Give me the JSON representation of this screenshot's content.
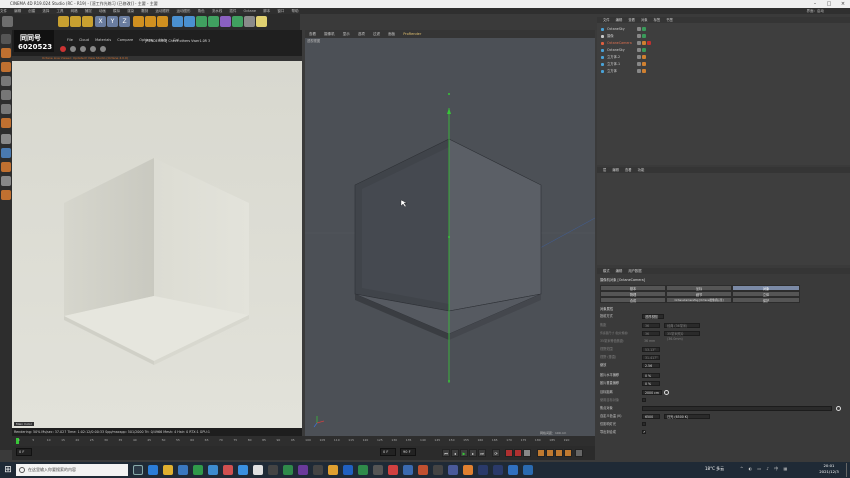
{
  "window": {
    "title": "CINEMA 4D R19.024 Studio (RC - R19) - [渲工作光练习 (已修改)] - 主要 - 主要",
    "menu": [
      "文件",
      "编辑",
      "创建",
      "选择",
      "工具",
      "网格",
      "捕捉",
      "动画",
      "模拟",
      "渲染",
      "雕刻",
      "运动跟踪",
      "运动图形",
      "角色",
      "流水线",
      "插件",
      "Octane",
      "脚本",
      "窗口",
      "帮助"
    ],
    "layout_label": "界面：启动"
  },
  "render_view": {
    "logo_text": "同同号",
    "logo_number": "6020523",
    "menu": [
      "File",
      "Cloud",
      "Materials",
      "Compare",
      "Options",
      "Help",
      "Gui"
    ],
    "info": "[RENDERING] Check others Vwer1.0R 3",
    "warning": "Octane Live Viewer: Updated! View Studio (Octane 4.0.0)",
    "mode_label": "Main",
    "mode_value": "Color",
    "status": "Rendering: 50%  Ms/sec: 37.027   Time: 1:02:12/0:00:33  Spp/maxspp: 501/2000   Tri: 0/4966   Mesh: 4   Hair: 0   RTX:1   GPU:1"
  },
  "viewport": {
    "menu": [
      "查看",
      "摄像机",
      "显示",
      "选项",
      "过滤",
      "面板",
      "ProRender"
    ],
    "camera_label": "透视视图",
    "scale_label": "网格间距：100 cm"
  },
  "timeline": {
    "ticks": [
      "0",
      "5",
      "10",
      "15",
      "20",
      "25",
      "30",
      "35",
      "40",
      "45",
      "50",
      "55",
      "60",
      "65",
      "70",
      "75",
      "80",
      "85",
      "90",
      "95",
      "100",
      "105",
      "110",
      "115",
      "120",
      "125",
      "130",
      "135",
      "140",
      "145",
      "150",
      "155",
      "160",
      "165",
      "170",
      "175",
      "180",
      "185",
      "190"
    ],
    "frame_start": "0 F",
    "frame_end": "90 F",
    "frame_current": "0 F"
  },
  "object_manager": {
    "tabs": [
      "文件",
      "编辑",
      "查看",
      "对象",
      "标签",
      "书签"
    ],
    "objects": [
      {
        "name": "OctaneSky",
        "color": "#4aa3d8"
      },
      {
        "name": "摄像",
        "color": "#c8c8c8"
      },
      {
        "name": "OctaneCamera",
        "color": "#e06040"
      },
      {
        "name": "OctaneSky",
        "color": "#4aa3d8"
      },
      {
        "name": "立方体.2",
        "color": "#4aa3d8"
      },
      {
        "name": "立方体.1",
        "color": "#4aa3d8"
      },
      {
        "name": "立方体",
        "color": "#4aa3d8"
      }
    ]
  },
  "layer_panel": {
    "tabs": [
      "层",
      "编辑",
      "查看",
      "功能"
    ]
  },
  "attributes": {
    "tabs": [
      "模式",
      "编辑",
      "用户数据"
    ],
    "title": "摄像机对象 [OctaneCamera]",
    "segments_row1": [
      "基本",
      "坐标",
      "对象"
    ],
    "segments_row2": [
      "物理",
      "细节",
      "立体"
    ],
    "segments_row3": [
      "合成",
      "OctaneCameraTag [Octane摄像机标签]",
      "保护"
    ],
    "section": "对象属性",
    "rows": [
      {
        "label": "投射方式",
        "value": "透视视图",
        "dim": false
      },
      {
        "label": "焦距",
        "value": "36",
        "value2": "经典 (36毫米)",
        "dim": true
      },
      {
        "label": "传感器尺寸 (胶片规格)",
        "value": "36",
        "value2": "35毫米照片 (36.0mm)",
        "dim": true
      },
      {
        "label": "35毫米等值焦距:",
        "value": "36 mm",
        "dim": true
      },
      {
        "label": "视野范围",
        "value": "53.13°",
        "dim": true
      },
      {
        "label": "视野 (垂直)",
        "value": "31.417°",
        "dim": true
      },
      {
        "label": "缩放",
        "value": "2.56",
        "dim": false
      },
      {
        "label": "胶片水平偏移",
        "value": "0 %",
        "dim": false
      },
      {
        "label": "胶片垂直偏移",
        "value": "0 %",
        "dim": false
      },
      {
        "label": "目标距离",
        "value": "2000 cm",
        "dim": false
      },
      {
        "label": "使用目标对象",
        "value": "",
        "dim": true
      },
      {
        "label": "焦点对象",
        "value": "",
        "dim": false
      },
      {
        "label": "自定义色温 (K)",
        "value": "6500",
        "value2": "日光 (6500 K)",
        "dim": false
      },
      {
        "label": "仅影响灯光",
        "value": "",
        "dim": false
      },
      {
        "label": "导出到合成",
        "value": "",
        "dim": false
      }
    ]
  },
  "taskbar": {
    "search_placeholder": "在这里输入你要搜索的内容",
    "weather": "18°C  多云",
    "time": "20:01",
    "date": "2021/12/3"
  },
  "colors": {
    "accent_selected": "#7b8aa6",
    "render_bg": "#dcdcd4",
    "viewport_bg": "#4c5056",
    "axis_green": "#37c837"
  }
}
